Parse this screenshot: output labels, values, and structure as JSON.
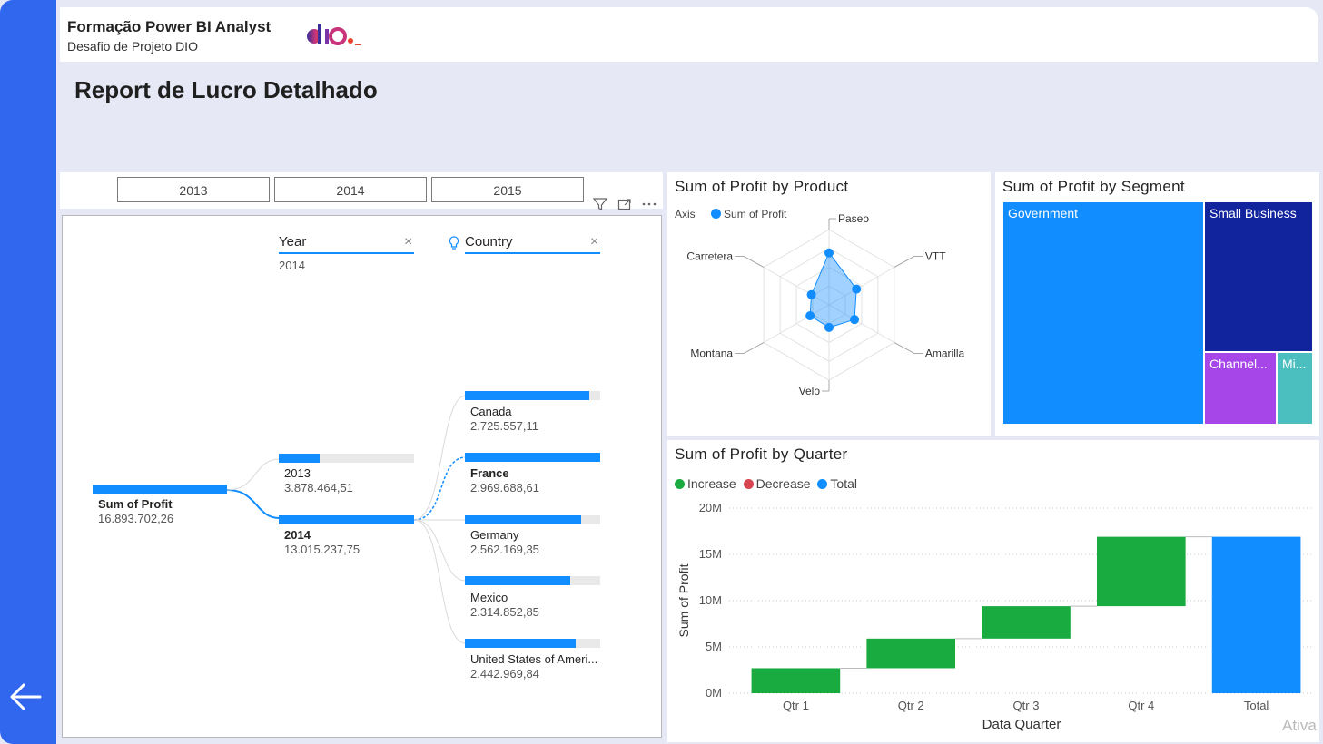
{
  "header": {
    "title": "Formação Power BI Analyst",
    "subtitle": "Desafio de Projeto DIO",
    "logo_text": "dio._"
  },
  "page": {
    "title": "Report de Lucro Detalhado"
  },
  "slicer": {
    "years": [
      "2013",
      "2014",
      "2015"
    ]
  },
  "decomposition_tree": {
    "levels": [
      {
        "name": "Year",
        "filter": "2014"
      },
      {
        "name": "Country",
        "filter": ""
      }
    ],
    "root": {
      "label": "Sum of Profit",
      "value": "16.893.702,26",
      "fill": 1.0
    },
    "years": [
      {
        "label": "2013",
        "value": "3.878.464,51",
        "fill": 0.3
      },
      {
        "label": "2014",
        "value": "13.015.237,75",
        "fill": 1.0
      }
    ],
    "countries": [
      {
        "label": "Canada",
        "value": "2.725.557,11",
        "fill": 0.92
      },
      {
        "label": "France",
        "value": "2.969.688,61",
        "fill": 1.0
      },
      {
        "label": "Germany",
        "value": "2.562.169,35",
        "fill": 0.86
      },
      {
        "label": "Mexico",
        "value": "2.314.852,85",
        "fill": 0.78
      },
      {
        "label": "United States of Ameri...",
        "value": "2.442.969,84",
        "fill": 0.82
      }
    ]
  },
  "radar": {
    "title": "Sum of Profit by Product",
    "legend_axis": "Axis",
    "legend_series": "Sum of Profit",
    "axes": [
      "Paseo",
      "VTT",
      "Amarilla",
      "Velo",
      "Montana",
      "Carretera"
    ],
    "values": [
      0.69,
      0.42,
      0.39,
      0.3,
      0.29,
      0.27
    ],
    "color": "#118dff"
  },
  "segments": {
    "title": "Sum of Profit by Segment",
    "items": [
      {
        "label": "Government",
        "color": "#118dff"
      },
      {
        "label": "Small Business",
        "color": "#12239e"
      },
      {
        "label": "Channel...",
        "color": "#a646e8"
      },
      {
        "label": "Mi...",
        "color": "#4bbfbf"
      }
    ]
  },
  "chart_data": {
    "type": "waterfall",
    "title": "Sum of Profit by Quarter",
    "xlabel": "Data Quarter",
    "ylabel": "Sum of Profit",
    "categories": [
      "Qtr 1",
      "Qtr 2",
      "Qtr 3",
      "Qtr 4",
      "Total"
    ],
    "values": [
      2700000,
      3200000,
      3500000,
      7500000,
      16900000
    ],
    "kind": [
      "increase",
      "increase",
      "increase",
      "increase",
      "total"
    ],
    "yticks": [
      "0M",
      "5M",
      "10M",
      "15M",
      "20M"
    ],
    "ylim": [
      0,
      20000000
    ],
    "legend": [
      {
        "name": "Increase",
        "color": "#1aab40"
      },
      {
        "name": "Decrease",
        "color": "#d64550"
      },
      {
        "name": "Total",
        "color": "#118dff"
      }
    ],
    "grid": true
  },
  "watermark": "Ativa"
}
